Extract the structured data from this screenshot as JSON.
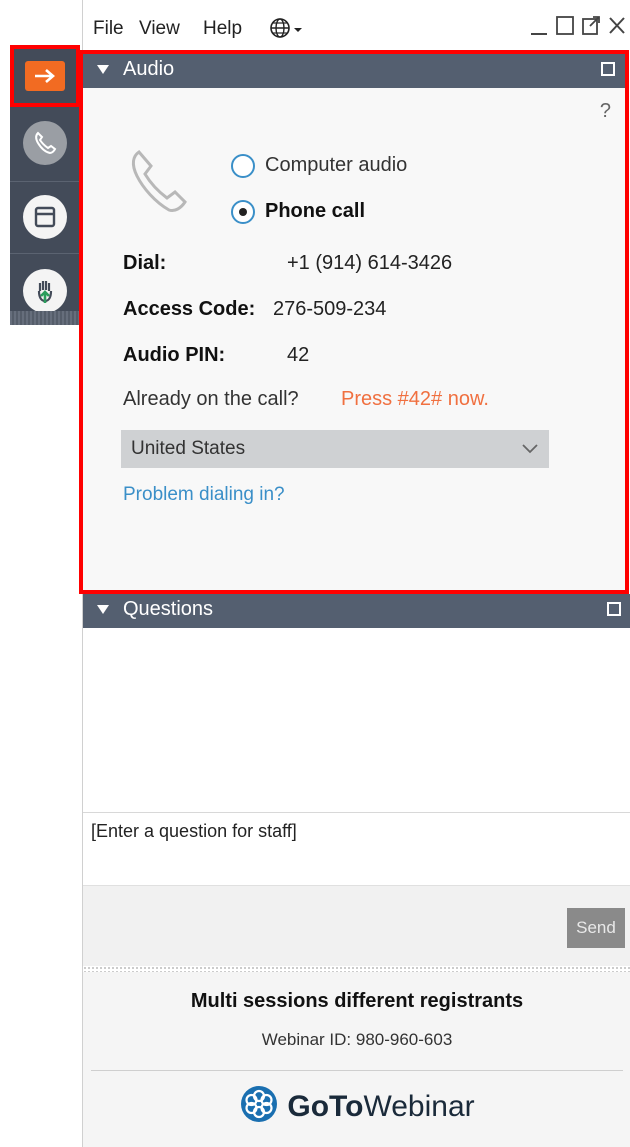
{
  "menubar": {
    "file": "File",
    "view": "View",
    "help": "Help"
  },
  "sidebar": {
    "items": [
      {
        "icon": "arrow-right-icon"
      },
      {
        "icon": "phone-icon"
      },
      {
        "icon": "window-icon"
      },
      {
        "icon": "raise-hand-icon"
      }
    ]
  },
  "audio": {
    "title": "Audio",
    "help": "?",
    "computer_audio": "Computer audio",
    "phone_call": "Phone call",
    "selected": "Phone call",
    "dial_label": "Dial:",
    "dial_value": "+1 (914) 614-3426",
    "access_label": "Access Code:",
    "access_value": "276-509-234",
    "pin_label": "Audio PIN:",
    "pin_value": "42",
    "already": "Already on the call?",
    "press": "Press #42# now.",
    "country": "United States",
    "problem_link": "Problem dialing in?"
  },
  "questions": {
    "title": "Questions",
    "input_placeholder": "[Enter a question for staff]",
    "send": "Send"
  },
  "footer": {
    "session_title": "Multi sessions different registrants",
    "webinar_id": "Webinar ID: 980-960-603",
    "brand_bold": "GoTo",
    "brand_light": "Webinar"
  },
  "colors": {
    "accent": "#f26b22",
    "header": "#545f70",
    "link": "#3a8fc8",
    "press": "#f07040"
  }
}
